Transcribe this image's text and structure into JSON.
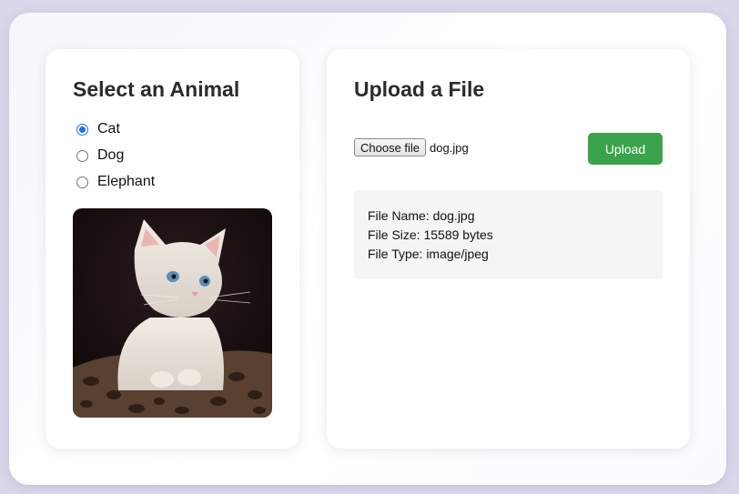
{
  "animal_panel": {
    "title": "Select an Animal",
    "options": [
      {
        "label": "Cat",
        "checked": true
      },
      {
        "label": "Dog",
        "checked": false
      },
      {
        "label": "Elephant",
        "checked": false
      }
    ],
    "selected": "Cat",
    "image_subject": "white kitten photo"
  },
  "upload_panel": {
    "title": "Upload a File",
    "choose_label": "Choose file",
    "chosen_file": "dog.jpg",
    "upload_label": "Upload",
    "upload_color": "#3aa24b",
    "info": {
      "name_line": "File Name: dog.jpg",
      "size_line": "File Size: 15589 bytes",
      "type_line": "File Type: image/jpeg"
    }
  },
  "colors": {
    "radio_checked": "#1f6fe5"
  }
}
